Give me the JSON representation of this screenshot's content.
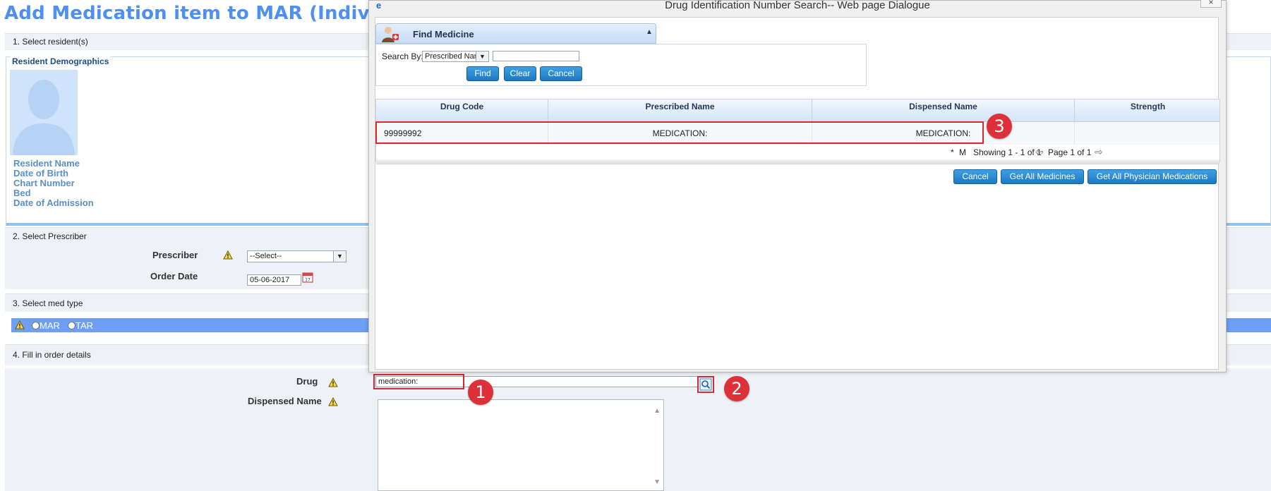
{
  "page": {
    "title": "Add Medication item to MAR (Individual)",
    "sections": {
      "select_resident": "1. Select resident(s)",
      "select_prescriber": "2. Select Prescriber",
      "select_med_type": "3. Select med type",
      "fill_order": "4. Fill in order details"
    },
    "demographics": {
      "legend": "Resident Demographics",
      "labels": [
        "Resident Name",
        "Date of Birth",
        "Chart Number",
        "Bed",
        "Date of Admission"
      ]
    },
    "prescriber": {
      "label": "Prescriber",
      "value": "--Select--"
    },
    "order_date": {
      "label": "Order Date",
      "value": "05-06-2017"
    },
    "med_type": {
      "options": [
        "MAR",
        "TAR"
      ]
    },
    "drug": {
      "label": "Drug",
      "value": "medication:"
    },
    "dispensed_name": {
      "label": "Dispensed Name"
    }
  },
  "dialog": {
    "title": "Drug Identification Number Search-- Web page Dialogue",
    "close_label": "×",
    "panel_title": "Find Medicine",
    "search_by_label": "Search By:",
    "search_by_value": "Prescribed Name",
    "search_value": "",
    "buttons": {
      "find": "Find",
      "clear": "Clear",
      "cancel": "Cancel"
    },
    "grid": {
      "columns": [
        "Drug Code",
        "Prescribed Name",
        "Dispensed Name",
        "Strength"
      ],
      "rows": [
        {
          "drug_code": "99999992",
          "prescribed_name": "MEDICATION:",
          "dispensed_name": "MEDICATION:",
          "strength": ""
        }
      ],
      "pager": {
        "marker": "*",
        "mode": "M",
        "showing": "Showing 1 - 1 of 1",
        "page": "Page 1 of 1"
      }
    },
    "footer_buttons": {
      "cancel": "Cancel",
      "get_all_medicines": "Get All Medicines",
      "get_all_physician_medications": "Get All Physician Medications"
    }
  },
  "annotations": [
    "1",
    "2",
    "3"
  ],
  "colors": {
    "title_blue": "#4f8ff0",
    "button_blue": "#1e78c2",
    "annotation_red": "#d9282f",
    "med_type_bar": "#6f9ff5"
  },
  "icons": [
    "warning-icon",
    "calendar-icon",
    "search-icon",
    "ie-icon",
    "collapse-icon",
    "pharmacist-icon",
    "prev-page-icon",
    "next-page-icon"
  ]
}
